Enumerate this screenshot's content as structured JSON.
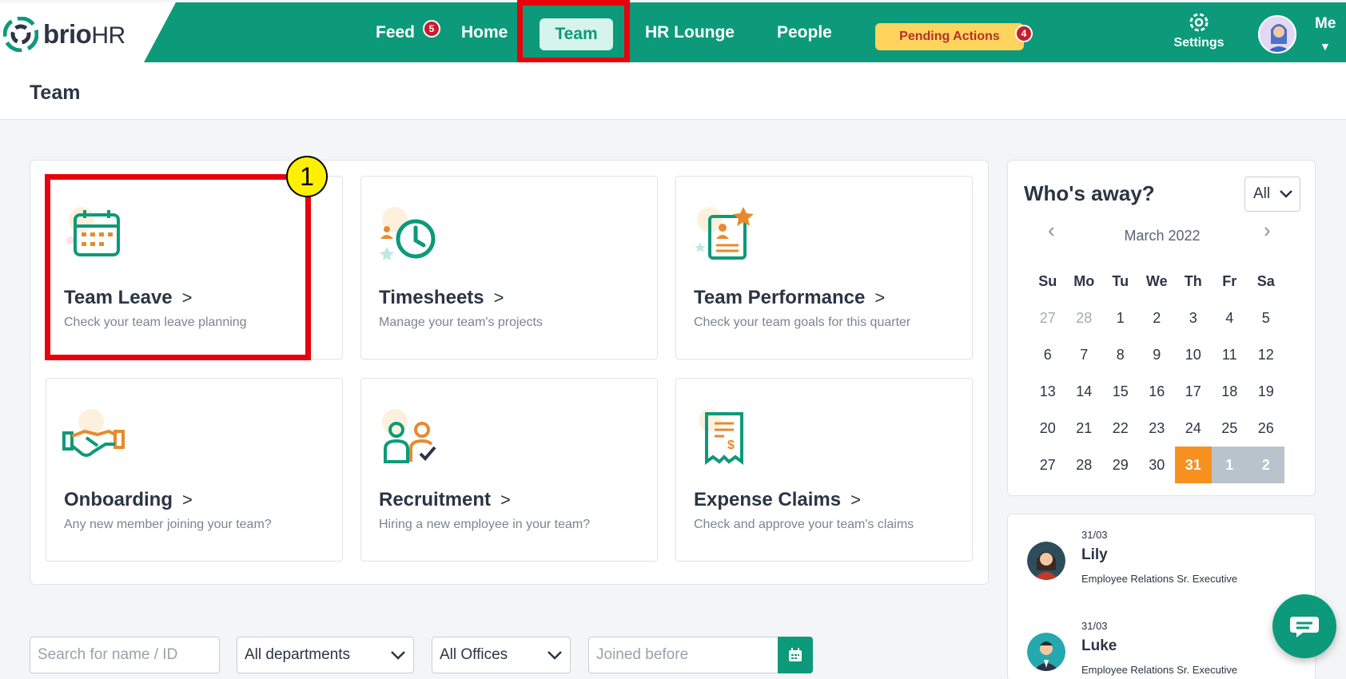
{
  "nav": {
    "logo_brio": "brio",
    "logo_hr": "HR",
    "feed": "Feed",
    "feed_badge": "5",
    "home": "Home",
    "team": "Team",
    "hr_lounge": "HR Lounge",
    "people": "People",
    "pending": "Pending Actions",
    "pending_badge": "4",
    "settings": "Settings",
    "me": "Me"
  },
  "page": {
    "title": "Team"
  },
  "annotation": {
    "step": "1"
  },
  "cards": [
    {
      "title": "Team Leave",
      "desc": "Check your team leave planning",
      "icon": "calendar-icon"
    },
    {
      "title": "Timesheets",
      "desc": "Manage your team's projects",
      "icon": "clock-icon"
    },
    {
      "title": "Team Performance",
      "desc": "Check your team goals for this quarter",
      "icon": "performance-icon"
    },
    {
      "title": "Onboarding",
      "desc": "Any new member joining your team?",
      "icon": "handshake-icon"
    },
    {
      "title": "Recruitment",
      "desc": "Hiring a new employee in your team?",
      "icon": "recruitment-icon"
    },
    {
      "title": "Expense Claims",
      "desc": "Check and approve your team's claims",
      "icon": "receipt-icon"
    }
  ],
  "away": {
    "title": "Who's away?",
    "filter": "All",
    "month": "March 2022",
    "weekdays": [
      "Su",
      "Mo",
      "Tu",
      "We",
      "Th",
      "Fr",
      "Sa"
    ],
    "days": [
      {
        "d": "27",
        "s": "muted"
      },
      {
        "d": "28",
        "s": "muted"
      },
      {
        "d": "1",
        "s": ""
      },
      {
        "d": "2",
        "s": ""
      },
      {
        "d": "3",
        "s": ""
      },
      {
        "d": "4",
        "s": ""
      },
      {
        "d": "5",
        "s": ""
      },
      {
        "d": "6",
        "s": ""
      },
      {
        "d": "7",
        "s": ""
      },
      {
        "d": "8",
        "s": ""
      },
      {
        "d": "9",
        "s": ""
      },
      {
        "d": "10",
        "s": ""
      },
      {
        "d": "11",
        "s": ""
      },
      {
        "d": "12",
        "s": ""
      },
      {
        "d": "13",
        "s": ""
      },
      {
        "d": "14",
        "s": ""
      },
      {
        "d": "15",
        "s": ""
      },
      {
        "d": "16",
        "s": ""
      },
      {
        "d": "17",
        "s": ""
      },
      {
        "d": "18",
        "s": ""
      },
      {
        "d": "19",
        "s": ""
      },
      {
        "d": "20",
        "s": ""
      },
      {
        "d": "21",
        "s": ""
      },
      {
        "d": "22",
        "s": ""
      },
      {
        "d": "23",
        "s": ""
      },
      {
        "d": "24",
        "s": ""
      },
      {
        "d": "25",
        "s": ""
      },
      {
        "d": "26",
        "s": ""
      },
      {
        "d": "27",
        "s": ""
      },
      {
        "d": "28",
        "s": ""
      },
      {
        "d": "29",
        "s": ""
      },
      {
        "d": "30",
        "s": ""
      },
      {
        "d": "31",
        "s": "today"
      },
      {
        "d": "1",
        "s": "future"
      },
      {
        "d": "2",
        "s": "future"
      }
    ],
    "people": [
      {
        "date": "31/03",
        "name": "Lily",
        "role": "Employee Relations Sr. Executive"
      },
      {
        "date": "31/03",
        "name": "Luke",
        "role": "Employee Relations Sr. Executive"
      }
    ]
  },
  "filters": {
    "search_placeholder": "Search for name / ID",
    "department": "All departments",
    "office": "All Offices",
    "joined_placeholder": "Joined before"
  },
  "colors": {
    "brand_green": "#0c9a7a",
    "today": "#f7901e",
    "pending": "#ffd45c",
    "annotation_red": "#e8000b"
  }
}
